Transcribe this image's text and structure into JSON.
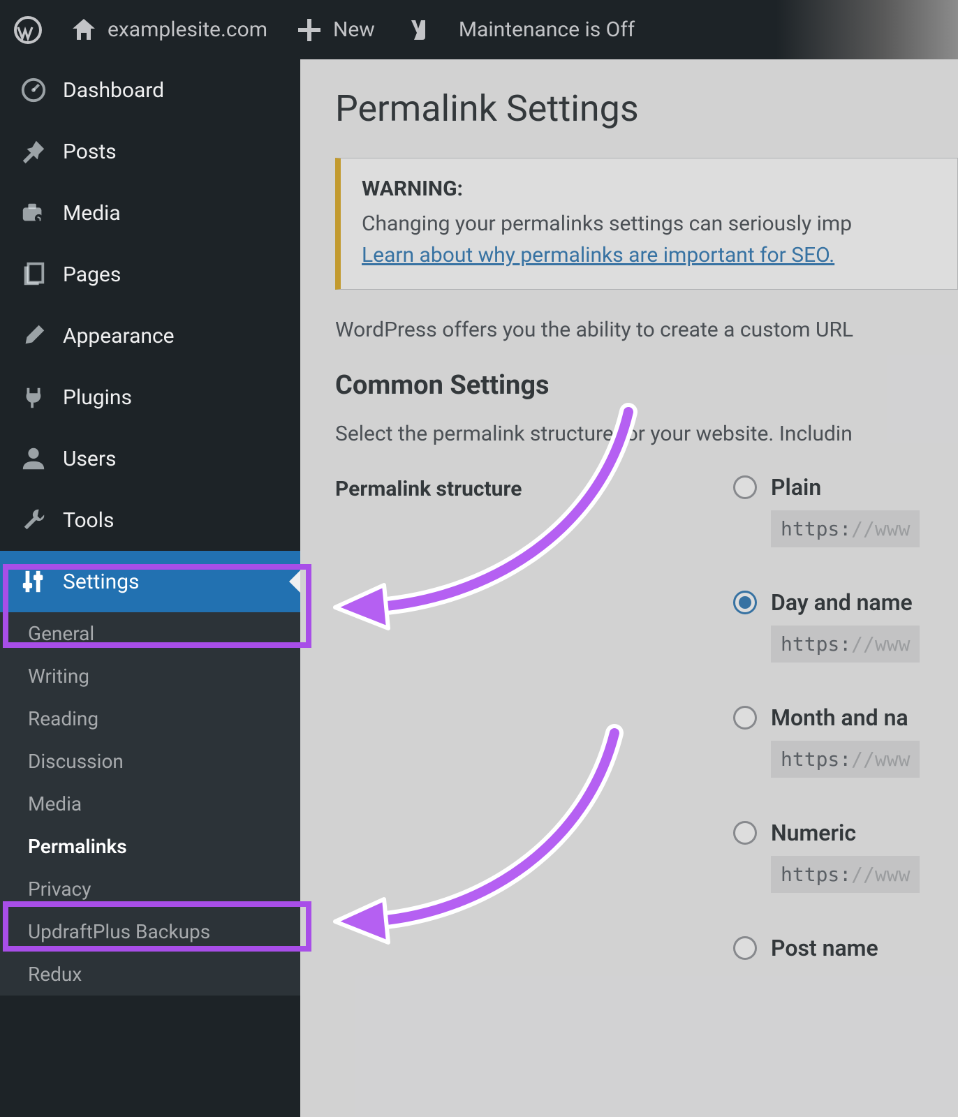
{
  "adminbar": {
    "site_name": "examplesite.com",
    "new_label": "New",
    "maintenance_label": "Maintenance is Off"
  },
  "sidebar": {
    "items": [
      {
        "label": "Dashboard"
      },
      {
        "label": "Posts"
      },
      {
        "label": "Media"
      },
      {
        "label": "Pages"
      },
      {
        "label": "Appearance"
      },
      {
        "label": "Plugins"
      },
      {
        "label": "Users"
      },
      {
        "label": "Tools"
      },
      {
        "label": "Settings"
      }
    ],
    "submenu": [
      {
        "label": "General"
      },
      {
        "label": "Writing"
      },
      {
        "label": "Reading"
      },
      {
        "label": "Discussion"
      },
      {
        "label": "Media"
      },
      {
        "label": "Permalinks"
      },
      {
        "label": "Privacy"
      },
      {
        "label": "UpdraftPlus Backups"
      },
      {
        "label": "Redux"
      }
    ]
  },
  "page": {
    "title": "Permalink Settings",
    "warning_title": "WARNING:",
    "warning_text": "Changing your permalinks settings can seriously imp",
    "warning_link": "Learn about why permalinks are important for SEO.",
    "intro": "WordPress offers you the ability to create a custom URL",
    "section_title": "Common Settings",
    "section_sub": "Select the permalink structure for your website. Includin",
    "structure_label": "Permalink structure",
    "options": [
      {
        "label": "Plain",
        "selected": false,
        "url_proto": "https:",
        "url_rest": "//www"
      },
      {
        "label": "Day and name",
        "selected": true,
        "url_proto": "https:",
        "url_rest": "//www"
      },
      {
        "label": "Month and na",
        "selected": false,
        "url_proto": "https:",
        "url_rest": "//www"
      },
      {
        "label": "Numeric",
        "selected": false,
        "url_proto": "https:",
        "url_rest": "//www"
      },
      {
        "label": "Post name",
        "selected": false,
        "url_proto": "",
        "url_rest": ""
      }
    ]
  }
}
